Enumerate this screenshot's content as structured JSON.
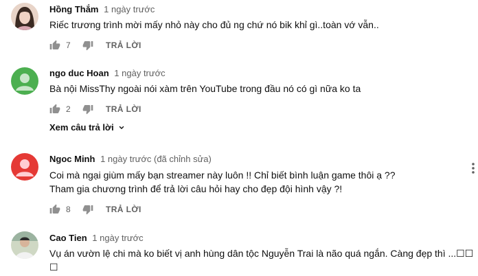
{
  "comments": [
    {
      "author": "Hồng Thắm",
      "time": "1 ngày trước",
      "lines": [
        "Riếc trương trình mời mấy nhỏ này cho đủ ng chứ nó bik khỉ gì..toàn vớ vẫn.."
      ],
      "likes": "7",
      "reply_label": "TRẢ LỜI",
      "avatar_icon": "profile-photo-woman"
    },
    {
      "author": "ngo duc Hoan",
      "time": "1 ngày trước",
      "lines": [
        "Bà nội MissThy ngoài nói xàm trên YouTube trong đầu nó có gì nữa ko ta"
      ],
      "likes": "2",
      "reply_label": "TRẢ LỜI",
      "view_replies": "Xem câu trả lời",
      "avatar_icon": "default-avatar-green"
    },
    {
      "author": "Ngoc Minh",
      "time": "1 ngày trước (đã chỉnh sửa)",
      "lines": [
        "Coi mà ngại giùm mấy bạn streamer này luôn !! Chỉ biết bình luận game thôi ạ ??",
        "Tham gia chương trình để trả lời câu hỏi hay cho đẹp đội hình vậy ?!"
      ],
      "likes": "8",
      "reply_label": "TRẢ LỜI",
      "avatar_icon": "default-avatar-red"
    },
    {
      "author": "Cao Tien",
      "time": "1 ngày trước",
      "lines": [
        "Vụ án vườn lệ chi mà ko biết vị anh hùng dân tộc Nguyễn Trai là não quá ngắn. Càng đẹp thì ...☐☐",
        "☐"
      ],
      "avatar_icon": "profile-photo-man"
    }
  ],
  "colors": {
    "avatar_green": "#4caf50",
    "avatar_red": "#e53935",
    "secondary_text": "#606060"
  }
}
